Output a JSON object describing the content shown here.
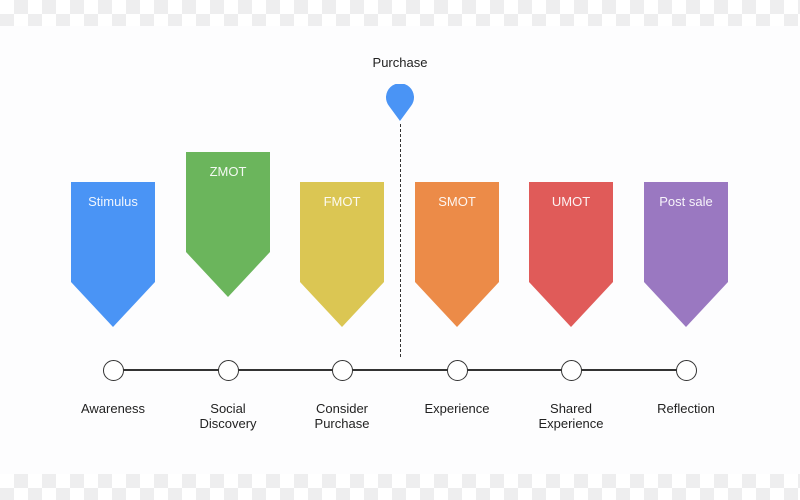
{
  "marker": {
    "label": "Purchase",
    "icon": "map-pin-icon",
    "color": "#4a94f5"
  },
  "flags": [
    {
      "label": "Stimulus",
      "color": "#4a94f5"
    },
    {
      "label": "ZMOT",
      "color": "#6bb55c"
    },
    {
      "label": "FMOT",
      "color": "#dbc653"
    },
    {
      "label": "SMOT",
      "color": "#ec8b48"
    },
    {
      "label": "UMOT",
      "color": "#e05b59"
    },
    {
      "label": "Post sale",
      "color": "#9a78c1"
    }
  ],
  "stages": [
    {
      "line1": "Awareness",
      "line2": ""
    },
    {
      "line1": "Social",
      "line2": "Discovery"
    },
    {
      "line1": "Consider",
      "line2": "Purchase"
    },
    {
      "line1": "Experience",
      "line2": ""
    },
    {
      "line1": "Shared",
      "line2": "Experience"
    },
    {
      "line1": "Reflection",
      "line2": ""
    }
  ]
}
